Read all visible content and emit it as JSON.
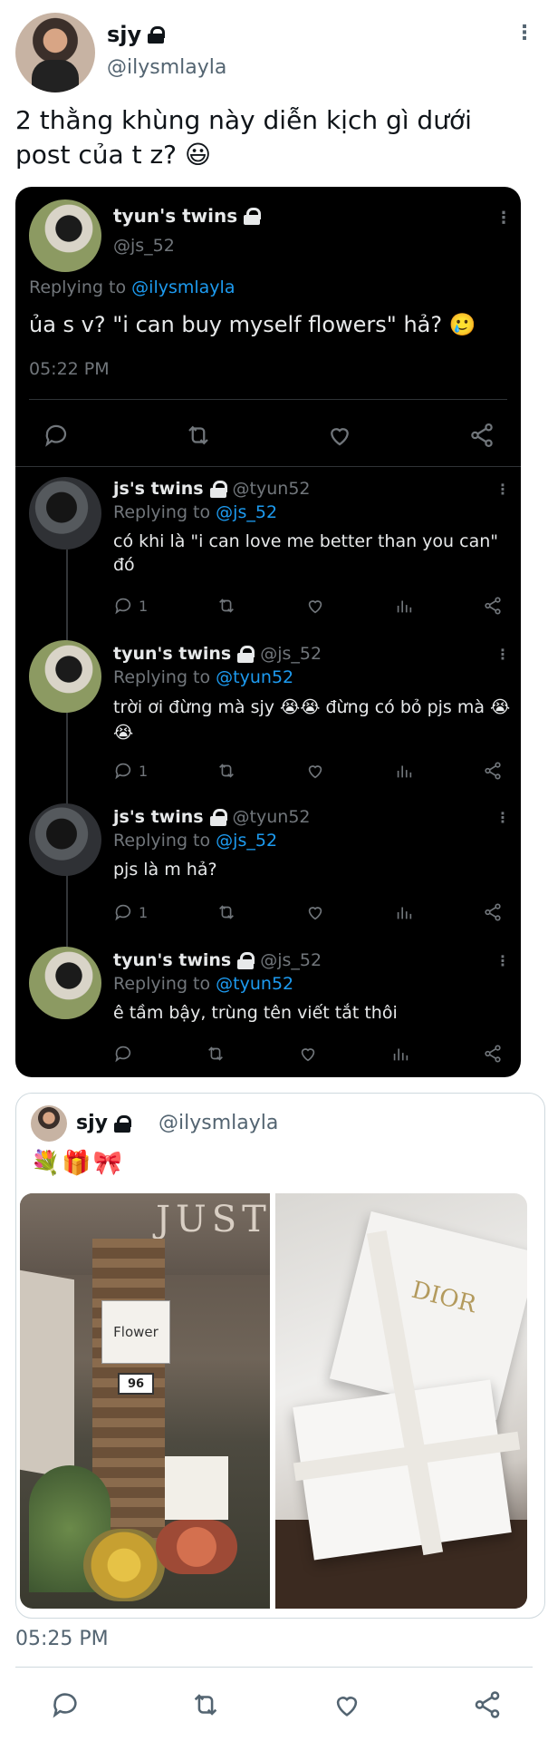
{
  "post": {
    "name": "sjy",
    "handle": "@ilysmlayla",
    "text": "2 thằng khùng này diễn kịch gì dưới post của t z? 😃",
    "time": "05:25 PM",
    "menu_glyph": "⋮"
  },
  "screenshot": {
    "main": {
      "name": "tyun's twins",
      "handle": "@js_52",
      "replying_prefix": "Replying to",
      "replying_to": "@ilysmlayla",
      "text": "ủa s v? \"i can buy myself flowers\" hả? 🥲",
      "time": "05:22 PM"
    },
    "replies": [
      {
        "name": "js's twins",
        "handle": "@tyun52",
        "replying_to": "@js_52",
        "text": "có khi là \"i can love me better than you can\" đó",
        "reply_count": "1"
      },
      {
        "name": "tyun's twins",
        "handle": "@js_52",
        "replying_to": "@tyun52",
        "text": "trời ơi đừng mà sjy 😭😭 đừng có bỏ pjs mà 😭😭",
        "reply_count": "1"
      },
      {
        "name": "js's twins",
        "handle": "@tyun52",
        "replying_to": "@js_52",
        "text": "pjs là m hả?",
        "reply_count": "1"
      },
      {
        "name": "tyun's twins",
        "handle": "@js_52",
        "replying_to": "@tyun52",
        "text": "ê tầm bậy, trùng tên viết tắt thôi",
        "reply_count": ""
      }
    ]
  },
  "quoted": {
    "name": "sjy",
    "handle": "@ilysmlayla",
    "text": "💐🎁🎀",
    "image1": {
      "sign_top": "JUST",
      "sign_flower": "Flower",
      "number": "96"
    },
    "image2": {
      "brand": "DIOR"
    }
  },
  "icons": [
    "reply-icon",
    "retweet-icon",
    "like-icon",
    "views-icon",
    "share-icon",
    "lock-icon",
    "more-icon"
  ],
  "colors": {
    "link": "#1d9bf0",
    "dark_bg": "#000000",
    "muted": "#536471"
  }
}
